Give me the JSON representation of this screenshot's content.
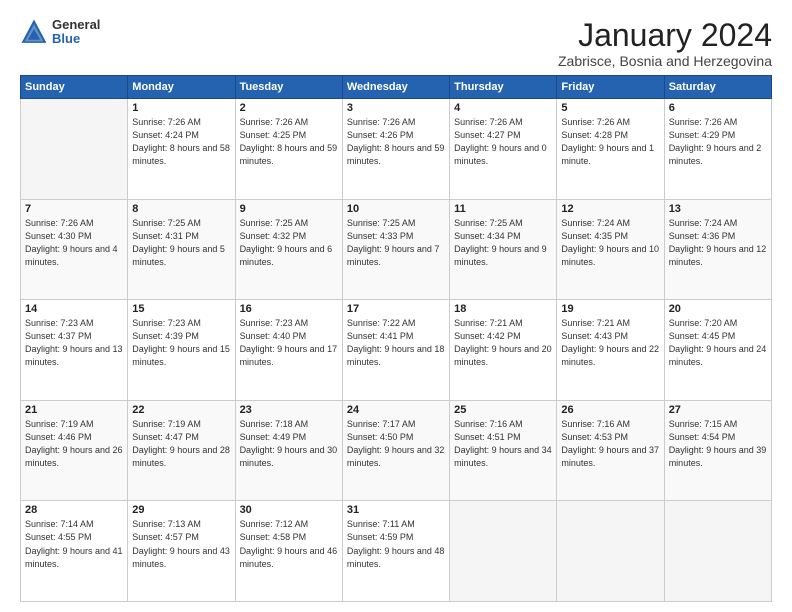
{
  "header": {
    "logo_general": "General",
    "logo_blue": "Blue",
    "month_title": "January 2024",
    "location": "Zabrisce, Bosnia and Herzegovina"
  },
  "weekdays": [
    "Sunday",
    "Monday",
    "Tuesday",
    "Wednesday",
    "Thursday",
    "Friday",
    "Saturday"
  ],
  "weeks": [
    [
      {
        "day": "",
        "sunrise": "",
        "sunset": "",
        "daylight": ""
      },
      {
        "day": "1",
        "sunrise": "Sunrise: 7:26 AM",
        "sunset": "Sunset: 4:24 PM",
        "daylight": "Daylight: 8 hours and 58 minutes."
      },
      {
        "day": "2",
        "sunrise": "Sunrise: 7:26 AM",
        "sunset": "Sunset: 4:25 PM",
        "daylight": "Daylight: 8 hours and 59 minutes."
      },
      {
        "day": "3",
        "sunrise": "Sunrise: 7:26 AM",
        "sunset": "Sunset: 4:26 PM",
        "daylight": "Daylight: 8 hours and 59 minutes."
      },
      {
        "day": "4",
        "sunrise": "Sunrise: 7:26 AM",
        "sunset": "Sunset: 4:27 PM",
        "daylight": "Daylight: 9 hours and 0 minutes."
      },
      {
        "day": "5",
        "sunrise": "Sunrise: 7:26 AM",
        "sunset": "Sunset: 4:28 PM",
        "daylight": "Daylight: 9 hours and 1 minute."
      },
      {
        "day": "6",
        "sunrise": "Sunrise: 7:26 AM",
        "sunset": "Sunset: 4:29 PM",
        "daylight": "Daylight: 9 hours and 2 minutes."
      }
    ],
    [
      {
        "day": "7",
        "sunrise": "Sunrise: 7:26 AM",
        "sunset": "Sunset: 4:30 PM",
        "daylight": "Daylight: 9 hours and 4 minutes."
      },
      {
        "day": "8",
        "sunrise": "Sunrise: 7:25 AM",
        "sunset": "Sunset: 4:31 PM",
        "daylight": "Daylight: 9 hours and 5 minutes."
      },
      {
        "day": "9",
        "sunrise": "Sunrise: 7:25 AM",
        "sunset": "Sunset: 4:32 PM",
        "daylight": "Daylight: 9 hours and 6 minutes."
      },
      {
        "day": "10",
        "sunrise": "Sunrise: 7:25 AM",
        "sunset": "Sunset: 4:33 PM",
        "daylight": "Daylight: 9 hours and 7 minutes."
      },
      {
        "day": "11",
        "sunrise": "Sunrise: 7:25 AM",
        "sunset": "Sunset: 4:34 PM",
        "daylight": "Daylight: 9 hours and 9 minutes."
      },
      {
        "day": "12",
        "sunrise": "Sunrise: 7:24 AM",
        "sunset": "Sunset: 4:35 PM",
        "daylight": "Daylight: 9 hours and 10 minutes."
      },
      {
        "day": "13",
        "sunrise": "Sunrise: 7:24 AM",
        "sunset": "Sunset: 4:36 PM",
        "daylight": "Daylight: 9 hours and 12 minutes."
      }
    ],
    [
      {
        "day": "14",
        "sunrise": "Sunrise: 7:23 AM",
        "sunset": "Sunset: 4:37 PM",
        "daylight": "Daylight: 9 hours and 13 minutes."
      },
      {
        "day": "15",
        "sunrise": "Sunrise: 7:23 AM",
        "sunset": "Sunset: 4:39 PM",
        "daylight": "Daylight: 9 hours and 15 minutes."
      },
      {
        "day": "16",
        "sunrise": "Sunrise: 7:23 AM",
        "sunset": "Sunset: 4:40 PM",
        "daylight": "Daylight: 9 hours and 17 minutes."
      },
      {
        "day": "17",
        "sunrise": "Sunrise: 7:22 AM",
        "sunset": "Sunset: 4:41 PM",
        "daylight": "Daylight: 9 hours and 18 minutes."
      },
      {
        "day": "18",
        "sunrise": "Sunrise: 7:21 AM",
        "sunset": "Sunset: 4:42 PM",
        "daylight": "Daylight: 9 hours and 20 minutes."
      },
      {
        "day": "19",
        "sunrise": "Sunrise: 7:21 AM",
        "sunset": "Sunset: 4:43 PM",
        "daylight": "Daylight: 9 hours and 22 minutes."
      },
      {
        "day": "20",
        "sunrise": "Sunrise: 7:20 AM",
        "sunset": "Sunset: 4:45 PM",
        "daylight": "Daylight: 9 hours and 24 minutes."
      }
    ],
    [
      {
        "day": "21",
        "sunrise": "Sunrise: 7:19 AM",
        "sunset": "Sunset: 4:46 PM",
        "daylight": "Daylight: 9 hours and 26 minutes."
      },
      {
        "day": "22",
        "sunrise": "Sunrise: 7:19 AM",
        "sunset": "Sunset: 4:47 PM",
        "daylight": "Daylight: 9 hours and 28 minutes."
      },
      {
        "day": "23",
        "sunrise": "Sunrise: 7:18 AM",
        "sunset": "Sunset: 4:49 PM",
        "daylight": "Daylight: 9 hours and 30 minutes."
      },
      {
        "day": "24",
        "sunrise": "Sunrise: 7:17 AM",
        "sunset": "Sunset: 4:50 PM",
        "daylight": "Daylight: 9 hours and 32 minutes."
      },
      {
        "day": "25",
        "sunrise": "Sunrise: 7:16 AM",
        "sunset": "Sunset: 4:51 PM",
        "daylight": "Daylight: 9 hours and 34 minutes."
      },
      {
        "day": "26",
        "sunrise": "Sunrise: 7:16 AM",
        "sunset": "Sunset: 4:53 PM",
        "daylight": "Daylight: 9 hours and 37 minutes."
      },
      {
        "day": "27",
        "sunrise": "Sunrise: 7:15 AM",
        "sunset": "Sunset: 4:54 PM",
        "daylight": "Daylight: 9 hours and 39 minutes."
      }
    ],
    [
      {
        "day": "28",
        "sunrise": "Sunrise: 7:14 AM",
        "sunset": "Sunset: 4:55 PM",
        "daylight": "Daylight: 9 hours and 41 minutes."
      },
      {
        "day": "29",
        "sunrise": "Sunrise: 7:13 AM",
        "sunset": "Sunset: 4:57 PM",
        "daylight": "Daylight: 9 hours and 43 minutes."
      },
      {
        "day": "30",
        "sunrise": "Sunrise: 7:12 AM",
        "sunset": "Sunset: 4:58 PM",
        "daylight": "Daylight: 9 hours and 46 minutes."
      },
      {
        "day": "31",
        "sunrise": "Sunrise: 7:11 AM",
        "sunset": "Sunset: 4:59 PM",
        "daylight": "Daylight: 9 hours and 48 minutes."
      },
      {
        "day": "",
        "sunrise": "",
        "sunset": "",
        "daylight": ""
      },
      {
        "day": "",
        "sunrise": "",
        "sunset": "",
        "daylight": ""
      },
      {
        "day": "",
        "sunrise": "",
        "sunset": "",
        "daylight": ""
      }
    ]
  ]
}
